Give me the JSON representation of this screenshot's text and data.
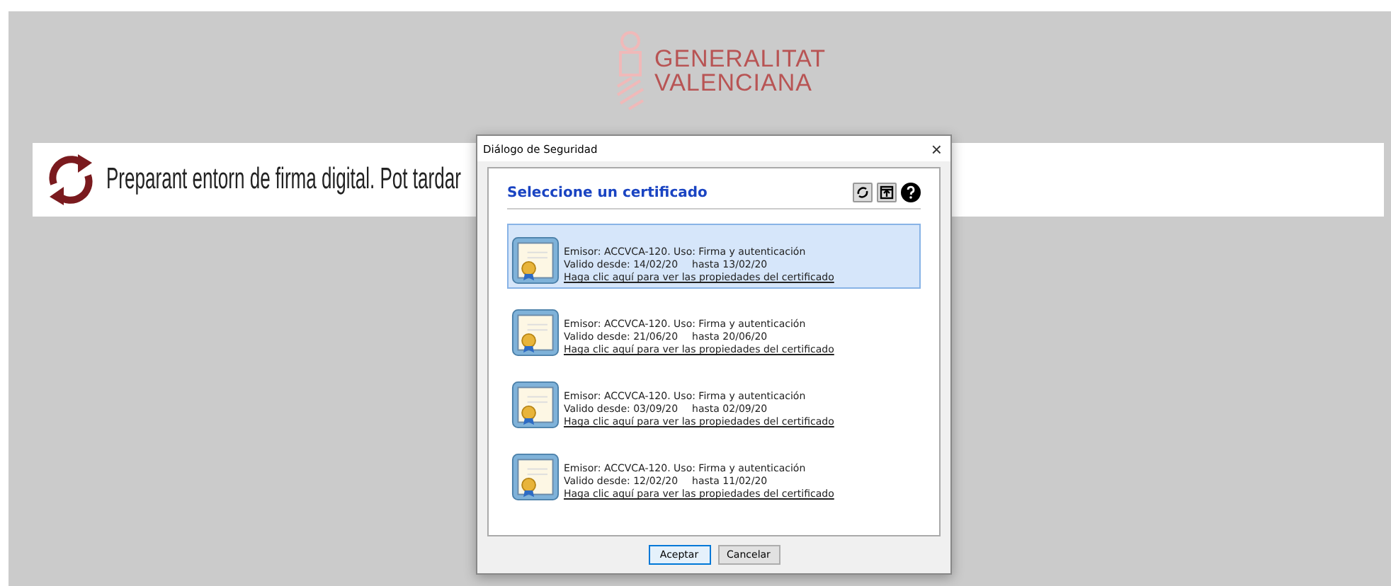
{
  "logo": {
    "line_1": "GENERALITAT",
    "line_2": "VALENCIANA"
  },
  "banner": {
    "text": "Preparant entorn de firma digital. Pot tardar"
  },
  "dialog": {
    "title": "Diálogo de Seguridad",
    "close": "×",
    "heading": "Seleccione un certificado",
    "certificates": [
      {
        "issuer": "Emisor: ACCVCA-120. Uso: Firma y autenticación",
        "from": "Valido desde: 14/02/20",
        "to": "hasta 13/02/20",
        "link": "Haga clic aquí para ver las propiedades del certificado",
        "selected": true
      },
      {
        "issuer": "Emisor: ACCVCA-120. Uso: Firma y autenticación",
        "from": "Valido desde: 21/06/20",
        "to": "hasta 20/06/20",
        "link": "Haga clic aquí para ver las propiedades del certificado",
        "selected": false
      },
      {
        "issuer": "Emisor: ACCVCA-120. Uso: Firma y autenticación",
        "from": "Valido desde: 03/09/20",
        "to": "hasta 02/09/20",
        "link": "Haga clic aquí para ver las propiedades del certificado",
        "selected": false
      },
      {
        "issuer": "Emisor: ACCVCA-120. Uso: Firma y autenticación",
        "from": "Valido desde: 12/02/20",
        "to": "hasta 11/02/20",
        "link": "Haga clic aquí para ver las propiedades del certificado",
        "selected": false
      }
    ],
    "buttons": [
      {
        "label": "Aceptar",
        "focused": true
      },
      {
        "label": "Cancelar",
        "focused": false
      }
    ]
  }
}
